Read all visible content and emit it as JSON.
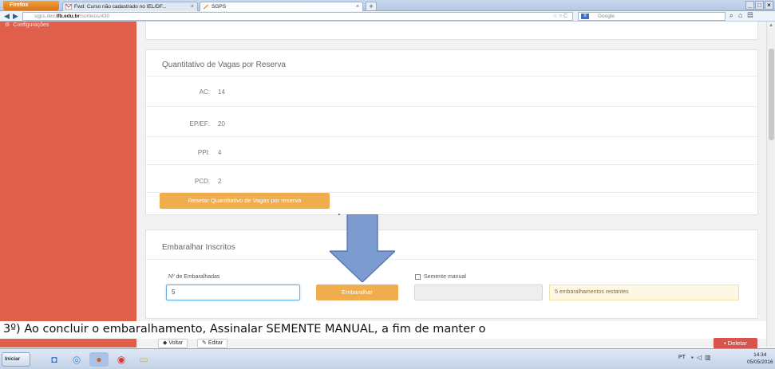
{
  "browser": {
    "firefox_label": "Firefox",
    "tabs": [
      {
        "label": "Fwd: Curso não cadastrado no IEL/DF..."
      },
      {
        "label": "SGPS"
      }
    ],
    "url_host": "sgps.dev.ifb.edu.br",
    "url_path": "/sorteios/430",
    "url_prefix": "sgps.dev.",
    "search_placeholder": "Google",
    "window_controls": [
      "_",
      "□",
      "×"
    ]
  },
  "sidebar": {
    "items": [
      {
        "label": "Configurações"
      }
    ]
  },
  "quota_panel": {
    "title": "Quantitativo de Vagas por Reserva",
    "rows": [
      {
        "label": "AC:",
        "value": "14"
      },
      {
        "label": "EP/EF:",
        "value": "20"
      },
      {
        "label": "PPI:",
        "value": "4"
      },
      {
        "label": "PCD:",
        "value": "2"
      }
    ],
    "reset_button": "Resetar Quantitativo de Vagas por reserva"
  },
  "shuffle_panel": {
    "title": "Embaralhar Inscritos",
    "shuffles_label": "Nº de Embaralhadas",
    "shuffles_value": "5",
    "shuffle_button": "Embaralhar",
    "manual_seed_label": "Semente manual",
    "manual_seed_value": "",
    "remaining_text": "5 embaralhamentos restantes"
  },
  "caption": "3º) Ao concluir o embaralhamento, Assinalar SEMENTE MANUAL, a fim de manter o",
  "actions": {
    "back": "Voltar",
    "edit": "Editar",
    "delete": "Deletar"
  },
  "taskbar": {
    "start": "Iniciar",
    "lang": "PT",
    "time": "14:34",
    "date": "05/05/2016"
  },
  "colors": {
    "sidebar": "#e05f4b",
    "orange_button": "#f0ad4e",
    "delete_button": "#d9534f",
    "arrow": "#7b9bd1"
  }
}
